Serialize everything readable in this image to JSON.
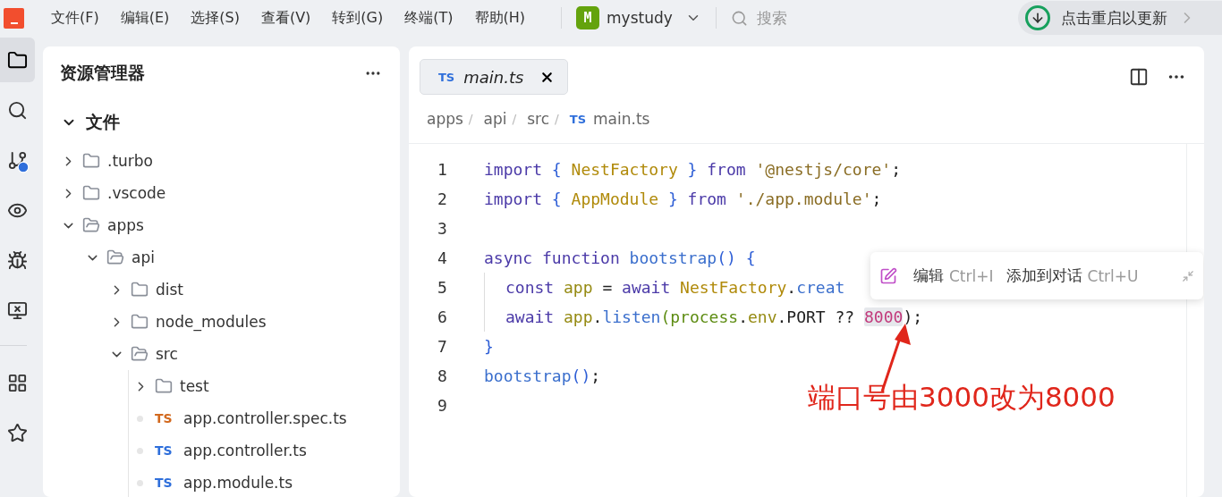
{
  "menu_bar": {
    "items": [
      "文件(F)",
      "编辑(E)",
      "选择(S)",
      "查看(V)",
      "转到(G)",
      "终端(T)",
      "帮助(H)"
    ]
  },
  "project": {
    "badge": "M",
    "name": "mystudy"
  },
  "search": {
    "placeholder": "搜索"
  },
  "update_button": {
    "label": "点击重启以更新"
  },
  "activity_bar": {
    "items": [
      {
        "kind": "files",
        "selected": true
      },
      {
        "kind": "search",
        "selected": false
      },
      {
        "kind": "branch",
        "selected": false
      },
      {
        "kind": "eye",
        "selected": false
      },
      {
        "kind": "bug",
        "selected": false
      },
      {
        "kind": "remote",
        "selected": false
      }
    ],
    "bottom_items": [
      {
        "kind": "grid",
        "selected": false
      },
      {
        "kind": "star",
        "selected": false
      }
    ]
  },
  "explorer": {
    "title": "资源管理器",
    "section": {
      "label": "文件",
      "expanded": true
    },
    "tree": [
      {
        "name": ".turbo",
        "kind": "folder",
        "expanded": false
      },
      {
        "name": ".vscode",
        "kind": "folder",
        "expanded": false
      },
      {
        "name": "apps",
        "kind": "folder",
        "expanded": true,
        "children": [
          {
            "name": "api",
            "kind": "folder",
            "expanded": true,
            "children": [
              {
                "name": "dist",
                "kind": "folder",
                "expanded": false
              },
              {
                "name": "node_modules",
                "kind": "folder",
                "expanded": false
              },
              {
                "name": "src",
                "kind": "folder",
                "expanded": true,
                "children": [
                  {
                    "name": "test",
                    "kind": "folder",
                    "expanded": false
                  },
                  {
                    "name": "app.controller.spec.ts",
                    "kind": "file",
                    "badge": "TS",
                    "color": "#d2691e"
                  },
                  {
                    "name": "app.controller.ts",
                    "kind": "file",
                    "badge": "TS",
                    "color": "#2f6fdb"
                  },
                  {
                    "name": "app.module.ts",
                    "kind": "file",
                    "badge": "TS",
                    "color": "#2f6fdb"
                  }
                ]
              }
            ]
          }
        ]
      }
    ]
  },
  "editor": {
    "tab": {
      "badge": "TS",
      "label": "main.ts",
      "selected": true
    },
    "breadcrumbs": [
      {
        "label": "apps",
        "separator": "/"
      },
      {
        "label": "api",
        "separator": "/"
      },
      {
        "label": "src",
        "separator": "/"
      },
      {
        "label": "main.ts",
        "badge": "TS"
      }
    ],
    "lines": [
      {
        "number": "1",
        "indented": false,
        "tokens": [
          {
            "t": "import ",
            "kind": "kw"
          },
          {
            "t": "{ ",
            "kind": "brace"
          },
          {
            "t": "NestFactory ",
            "kind": "type"
          },
          {
            "t": "} ",
            "kind": "brace"
          },
          {
            "t": "from ",
            "kind": "kw"
          },
          {
            "t": "'@nestjs/core'",
            "kind": "string"
          },
          {
            "t": ";",
            "kind": "plain"
          }
        ]
      },
      {
        "number": "2",
        "indented": false,
        "tokens": [
          {
            "t": "import ",
            "kind": "kw"
          },
          {
            "t": "{ ",
            "kind": "brace"
          },
          {
            "t": "AppModule ",
            "kind": "type"
          },
          {
            "t": "} ",
            "kind": "brace"
          },
          {
            "t": "from ",
            "kind": "kw"
          },
          {
            "t": "'./app.module'",
            "kind": "string"
          },
          {
            "t": ";",
            "kind": "plain"
          }
        ]
      },
      {
        "number": "3",
        "indented": false
      },
      {
        "number": "4",
        "indented": false,
        "tokens": [
          {
            "t": "async ",
            "kind": "kw"
          },
          {
            "t": "function ",
            "kind": "kw"
          },
          {
            "t": "bootstrap",
            "kind": "func"
          },
          {
            "t": "() ",
            "kind": "brace"
          },
          {
            "t": "{",
            "kind": "brace"
          }
        ]
      },
      {
        "number": "5",
        "indented": true,
        "tokens": [
          {
            "t": "const ",
            "kind": "kw"
          },
          {
            "t": "app",
            "kind": "var"
          },
          {
            "t": " = ",
            "kind": "plain"
          },
          {
            "t": "await ",
            "kind": "kw"
          },
          {
            "t": "NestFactory",
            "kind": "type"
          },
          {
            "t": ".",
            "kind": "plain"
          },
          {
            "t": "creat",
            "kind": "func"
          }
        ]
      },
      {
        "number": "6",
        "indented": true,
        "tokens": [
          {
            "t": "await ",
            "kind": "kw"
          },
          {
            "t": "app",
            "kind": "var"
          },
          {
            "t": ".",
            "kind": "plain"
          },
          {
            "t": "listen",
            "kind": "func"
          },
          {
            "t": "(",
            "kind": "paren"
          },
          {
            "t": "process",
            "kind": "global"
          },
          {
            "t": ".",
            "kind": "plain"
          },
          {
            "t": "env",
            "kind": "var"
          },
          {
            "t": ".PORT ?? ",
            "kind": "plain"
          },
          {
            "t": "8000",
            "kind": "number",
            "highlighted": true
          },
          {
            "t": ");",
            "kind": "plain"
          }
        ]
      },
      {
        "number": "7",
        "indented": false,
        "tokens": [
          {
            "t": "}",
            "kind": "brace"
          }
        ]
      },
      {
        "number": "8",
        "indented": false,
        "tokens": [
          {
            "t": "bootstrap",
            "kind": "func"
          },
          {
            "t": "()",
            "kind": "brace"
          },
          {
            "t": ";",
            "kind": "plain"
          }
        ]
      },
      {
        "number": "9",
        "indented": false
      }
    ]
  },
  "popup": {
    "items": [
      {
        "label": "编辑",
        "shortcut": "Ctrl+I"
      },
      {
        "label": "添加到对话",
        "shortcut": "Ctrl+U"
      }
    ]
  },
  "annotation": {
    "text": "端口号由3000改为8000"
  }
}
